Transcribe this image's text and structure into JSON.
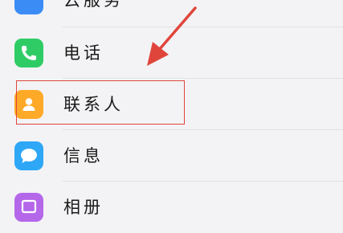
{
  "items": [
    {
      "label": "云服务",
      "icon": "cloud-icon",
      "color": "#3b8df5"
    },
    {
      "label": "电话",
      "icon": "phone-icon",
      "color": "#2fcc66"
    },
    {
      "label": "联系人",
      "icon": "contacts-icon",
      "color": "#ffa928"
    },
    {
      "label": "信息",
      "icon": "message-icon",
      "color": "#2ea7f6"
    },
    {
      "label": "相册",
      "icon": "gallery-icon",
      "color": "#b567ea"
    }
  ],
  "annotation": {
    "color": "#e0453c"
  }
}
